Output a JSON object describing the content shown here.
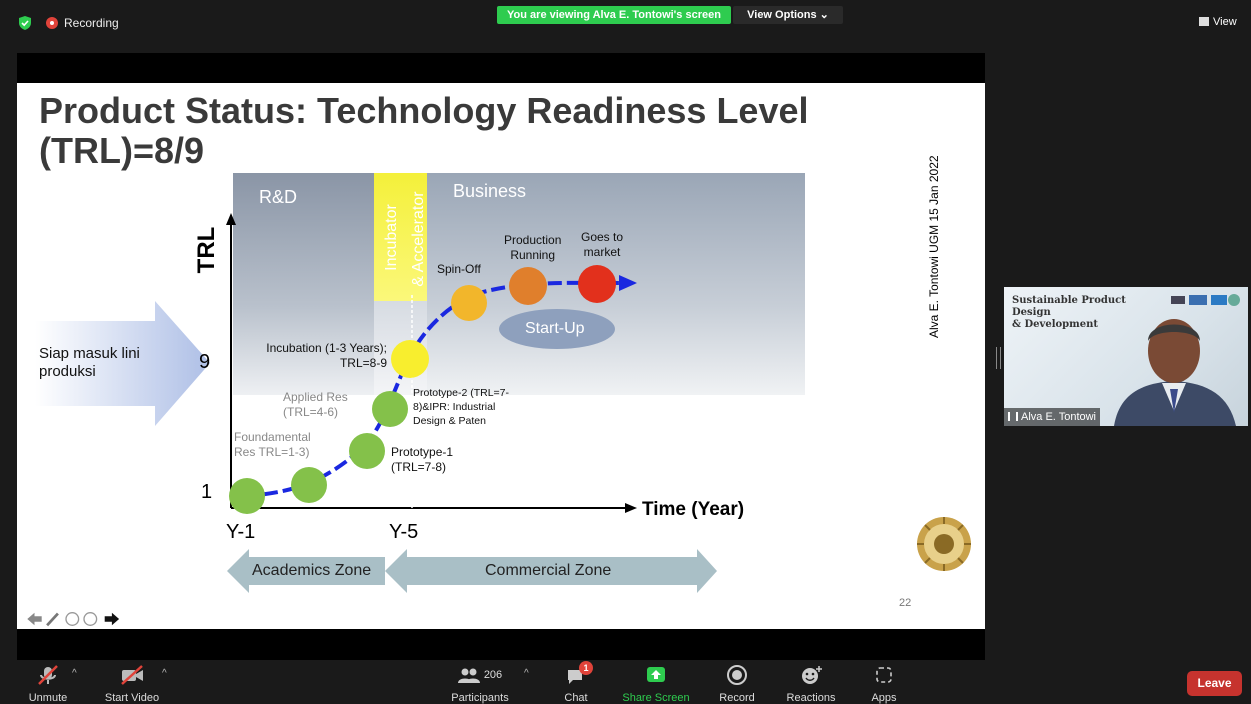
{
  "topbar": {
    "recording_label": "Recording",
    "viewing_banner": "You are viewing Alva E. Tontowi's screen",
    "view_options": "View Options ⌄",
    "view_label": "View",
    "accent_green": "#2ecc4f",
    "recording_color": "#e0433a"
  },
  "slide": {
    "title_line1": "Product Status: Technology Readiness Level",
    "title_line2": "(TRL)=8/9",
    "vertical_credit": "Alva E. Tontowi UGM 15 Jan 2022",
    "page_number": "22",
    "rd_label": "R&D",
    "incubator_label_1": "Incubator",
    "incubator_label_2": "& Accelerator",
    "business_label": "Business",
    "trl_axis": "TRL",
    "time_axis": "Time (Year)",
    "level_1": "1",
    "level_9": "9",
    "y1": "Y-1",
    "y5": "Y-5",
    "siap_text": "Siap masuk lini produksi",
    "academics_zone": "Academics Zone",
    "commercial_zone": "Commercial Zone",
    "startup": "Start-Up",
    "labels": {
      "foundamental": "Foundamental Res TRL=1-3)",
      "applied_1": "Applied Res",
      "applied_2": "(TRL=4-6)",
      "prototype1_1": "Prototype-1",
      "prototype1_2": "(TRL=7-8)",
      "prototype2_1": "Prototype-2 (TRL=7-",
      "prototype2_2": "8)&IPR: Industrial",
      "prototype2_3": "Design & Paten",
      "incubation_1": "Incubation (1-3 Years);",
      "incubation_2": "TRL=8-9",
      "spinoff": "Spin-Off",
      "production_1": "Production",
      "production_2": "Running",
      "goes_1": "Goes to",
      "goes_2": "market"
    }
  },
  "video": {
    "banner_line1": "Sustainable Product Design",
    "banner_line2": "& Development",
    "participant_name": "Alva E. Tontowi"
  },
  "toolbar": {
    "unmute": "Unmute",
    "start_video": "Start Video",
    "participants_count": "206",
    "participants": "Participants",
    "chat": "Chat",
    "chat_badge": "1",
    "share_screen": "Share Screen",
    "record": "Record",
    "reactions": "Reactions",
    "apps": "Apps",
    "leave": "Leave",
    "share_color": "#2ecc4f",
    "leave_color": "#c6332e"
  }
}
